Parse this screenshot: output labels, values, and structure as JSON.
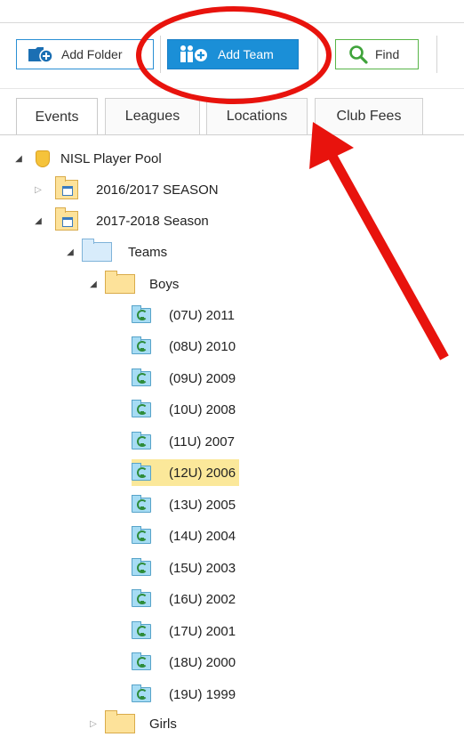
{
  "toolbar": {
    "add_folder": "Add Folder",
    "add_team": "Add Team",
    "find": "Find"
  },
  "tabs": [
    "Events",
    "Leagues",
    "Locations",
    "Club Fees"
  ],
  "tree": {
    "root": "NISL Player Pool",
    "season_2016": "2016/2017 SEASON",
    "season_2017": "2017-2018 Season",
    "teams": "Teams",
    "boys": "Boys",
    "boys_teams": [
      "(07U) 2011",
      "(08U) 2010",
      "(09U) 2009",
      "(10U) 2008",
      "(11U) 2007",
      "(12U) 2006",
      "(13U) 2005",
      "(14U) 2004",
      "(15U) 2003",
      "(16U) 2002",
      "(17U) 2001",
      "(18U) 2000",
      "(19U) 1999"
    ],
    "selected_team": "(12U) 2006",
    "girls": "Girls"
  },
  "colors": {
    "add_team_bg": "#1b8fd7",
    "find_border": "#58b548",
    "selection_highlight": "#fbe89a",
    "annotation_red": "#e8130d"
  }
}
